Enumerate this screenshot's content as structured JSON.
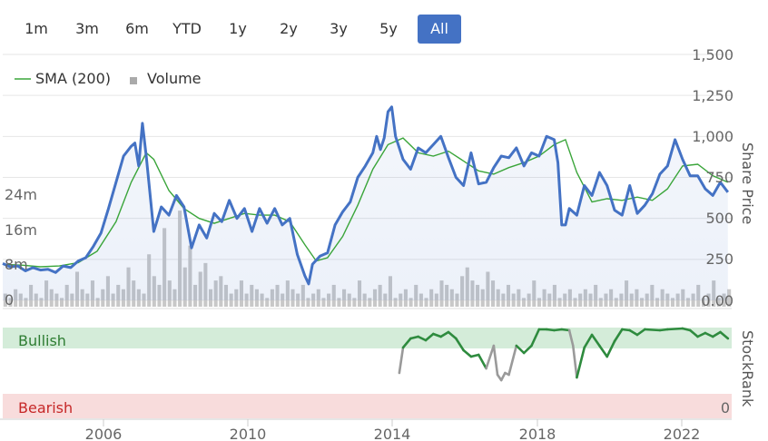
{
  "range_buttons": [
    {
      "label": "1m",
      "active": false
    },
    {
      "label": "3m",
      "active": false
    },
    {
      "label": "6m",
      "active": false
    },
    {
      "label": "YTD",
      "active": false
    },
    {
      "label": "1y",
      "active": false
    },
    {
      "label": "2y",
      "active": false
    },
    {
      "label": "3y",
      "active": false
    },
    {
      "label": "5y",
      "active": false
    },
    {
      "label": "All",
      "active": true
    }
  ],
  "legend": {
    "sma_label": "SMA (200)",
    "volume_label": "Volume"
  },
  "axes": {
    "share_price_title": "Share Price",
    "stockrank_title": "StockRank",
    "price_ticks": [
      "1,500",
      "1,250",
      "1,000",
      "750",
      "500",
      "250",
      "0.00"
    ],
    "volume_ticks": [
      "24m",
      "16m",
      "8m",
      "0"
    ],
    "year_ticks": [
      "2006",
      "2010",
      "2014",
      "2018",
      "2022"
    ],
    "stockrank_zero": "0"
  },
  "zones": {
    "bullish": "Bullish",
    "bearish": "Bearish"
  },
  "colors": {
    "price_line": "#4472c4",
    "sma_line": "#3aa53a",
    "volume_bars": "#c8c8c8",
    "active_button": "#4472c4",
    "bull_zone": "#d4ecd9",
    "bear_zone": "#f8dcdc",
    "rank_bull": "#2e8b3e",
    "rank_neutral": "#9a9a9a"
  },
  "chart_data": {
    "type": "line",
    "x_range": [
      "2004",
      "2023.3"
    ],
    "y_range": [
      0,
      1500
    ],
    "series": [
      {
        "name": "Share Price",
        "points": [
          [
            2004.0,
            225
          ],
          [
            2004.2,
            205
          ],
          [
            2004.4,
            210
          ],
          [
            2004.6,
            180
          ],
          [
            2004.8,
            200
          ],
          [
            2005.0,
            185
          ],
          [
            2005.2,
            190
          ],
          [
            2005.4,
            170
          ],
          [
            2005.6,
            210
          ],
          [
            2005.8,
            200
          ],
          [
            2006.0,
            240
          ],
          [
            2006.2,
            260
          ],
          [
            2006.4,
            330
          ],
          [
            2006.6,
            410
          ],
          [
            2006.8,
            560
          ],
          [
            2007.0,
            720
          ],
          [
            2007.2,
            880
          ],
          [
            2007.4,
            940
          ],
          [
            2007.5,
            960
          ],
          [
            2007.6,
            820
          ],
          [
            2007.7,
            1080
          ],
          [
            2007.8,
            880
          ],
          [
            2008.0,
            420
          ],
          [
            2008.2,
            570
          ],
          [
            2008.4,
            520
          ],
          [
            2008.6,
            640
          ],
          [
            2008.8,
            570
          ],
          [
            2009.0,
            320
          ],
          [
            2009.2,
            460
          ],
          [
            2009.4,
            380
          ],
          [
            2009.6,
            530
          ],
          [
            2009.8,
            480
          ],
          [
            2010.0,
            610
          ],
          [
            2010.2,
            500
          ],
          [
            2010.4,
            560
          ],
          [
            2010.6,
            420
          ],
          [
            2010.8,
            560
          ],
          [
            2011.0,
            470
          ],
          [
            2011.2,
            560
          ],
          [
            2011.4,
            460
          ],
          [
            2011.6,
            500
          ],
          [
            2011.8,
            280
          ],
          [
            2012.0,
            150
          ],
          [
            2012.1,
            100
          ],
          [
            2012.2,
            220
          ],
          [
            2012.4,
            270
          ],
          [
            2012.6,
            290
          ],
          [
            2012.8,
            460
          ],
          [
            2013.0,
            540
          ],
          [
            2013.2,
            600
          ],
          [
            2013.4,
            750
          ],
          [
            2013.6,
            820
          ],
          [
            2013.8,
            900
          ],
          [
            2013.9,
            1000
          ],
          [
            2014.0,
            920
          ],
          [
            2014.1,
            990
          ],
          [
            2014.2,
            1150
          ],
          [
            2014.3,
            1180
          ],
          [
            2014.4,
            1000
          ],
          [
            2014.6,
            860
          ],
          [
            2014.8,
            800
          ],
          [
            2015.0,
            930
          ],
          [
            2015.2,
            900
          ],
          [
            2015.4,
            950
          ],
          [
            2015.6,
            1000
          ],
          [
            2015.8,
            870
          ],
          [
            2016.0,
            750
          ],
          [
            2016.2,
            700
          ],
          [
            2016.4,
            900
          ],
          [
            2016.6,
            710
          ],
          [
            2016.8,
            720
          ],
          [
            2017.0,
            810
          ],
          [
            2017.2,
            880
          ],
          [
            2017.4,
            870
          ],
          [
            2017.6,
            930
          ],
          [
            2017.8,
            820
          ],
          [
            2018.0,
            900
          ],
          [
            2018.2,
            880
          ],
          [
            2018.4,
            1000
          ],
          [
            2018.6,
            980
          ],
          [
            2018.7,
            840
          ],
          [
            2018.8,
            460
          ],
          [
            2018.9,
            460
          ],
          [
            2019.0,
            560
          ],
          [
            2019.2,
            520
          ],
          [
            2019.4,
            700
          ],
          [
            2019.6,
            640
          ],
          [
            2019.8,
            780
          ],
          [
            2020.0,
            700
          ],
          [
            2020.2,
            550
          ],
          [
            2020.4,
            520
          ],
          [
            2020.6,
            700
          ],
          [
            2020.8,
            530
          ],
          [
            2021.0,
            580
          ],
          [
            2021.2,
            650
          ],
          [
            2021.4,
            770
          ],
          [
            2021.6,
            820
          ],
          [
            2021.8,
            980
          ],
          [
            2022.0,
            860
          ],
          [
            2022.2,
            760
          ],
          [
            2022.4,
            760
          ],
          [
            2022.6,
            680
          ],
          [
            2022.8,
            640
          ],
          [
            2023.0,
            720
          ],
          [
            2023.2,
            660
          ]
        ]
      },
      {
        "name": "SMA (200)",
        "points": [
          [
            2004.0,
            220
          ],
          [
            2004.5,
            215
          ],
          [
            2005.0,
            205
          ],
          [
            2005.5,
            210
          ],
          [
            2006.0,
            230
          ],
          [
            2006.5,
            300
          ],
          [
            2007.0,
            480
          ],
          [
            2007.4,
            720
          ],
          [
            2007.8,
            900
          ],
          [
            2008.0,
            860
          ],
          [
            2008.4,
            670
          ],
          [
            2008.8,
            560
          ],
          [
            2009.2,
            500
          ],
          [
            2009.6,
            470
          ],
          [
            2010.0,
            500
          ],
          [
            2010.4,
            530
          ],
          [
            2010.8,
            520
          ],
          [
            2011.2,
            520
          ],
          [
            2011.6,
            480
          ],
          [
            2012.0,
            340
          ],
          [
            2012.3,
            240
          ],
          [
            2012.6,
            260
          ],
          [
            2013.0,
            390
          ],
          [
            2013.4,
            580
          ],
          [
            2013.8,
            800
          ],
          [
            2014.2,
            950
          ],
          [
            2014.6,
            990
          ],
          [
            2015.0,
            900
          ],
          [
            2015.4,
            880
          ],
          [
            2015.8,
            910
          ],
          [
            2016.2,
            850
          ],
          [
            2016.6,
            790
          ],
          [
            2017.0,
            770
          ],
          [
            2017.4,
            810
          ],
          [
            2017.8,
            840
          ],
          [
            2018.2,
            880
          ],
          [
            2018.6,
            950
          ],
          [
            2018.9,
            980
          ],
          [
            2019.2,
            780
          ],
          [
            2019.6,
            600
          ],
          [
            2020.0,
            620
          ],
          [
            2020.4,
            610
          ],
          [
            2020.8,
            630
          ],
          [
            2021.2,
            610
          ],
          [
            2021.6,
            680
          ],
          [
            2022.0,
            820
          ],
          [
            2022.4,
            830
          ],
          [
            2022.8,
            760
          ],
          [
            2023.2,
            720
          ]
        ]
      },
      {
        "name": "Volume",
        "x_start": 2004.0,
        "x_end": 2023.3,
        "unit": "m",
        "values": [
          3,
          2,
          4,
          3,
          2,
          5,
          3,
          2,
          6,
          4,
          3,
          2,
          5,
          3,
          8,
          4,
          3,
          6,
          2,
          4,
          7,
          3,
          5,
          4,
          9,
          6,
          4,
          3,
          12,
          7,
          5,
          18,
          6,
          4,
          22,
          9,
          14,
          5,
          8,
          10,
          4,
          6,
          7,
          5,
          3,
          4,
          6,
          3,
          5,
          4,
          3,
          2,
          4,
          5,
          3,
          6,
          4,
          3,
          5,
          2,
          3,
          4,
          2,
          3,
          5,
          2,
          4,
          3,
          2,
          6,
          3,
          2,
          4,
          5,
          3,
          7,
          2,
          3,
          4,
          2,
          5,
          3,
          2,
          4,
          3,
          6,
          5,
          4,
          3,
          7,
          9,
          6,
          5,
          4,
          8,
          6,
          4,
          3,
          5,
          3,
          4,
          2,
          3,
          6,
          2,
          4,
          3,
          5,
          2,
          3,
          4,
          2,
          3,
          4,
          3,
          5,
          2,
          3,
          4,
          2,
          3,
          6,
          3,
          4,
          2,
          3,
          5,
          2,
          4,
          3,
          2,
          3,
          4,
          2,
          3,
          5,
          2,
          3,
          6,
          2,
          3,
          4
        ]
      }
    ],
    "stockrank": {
      "range": [
        0,
        100
      ],
      "points": [
        [
          2014.5,
          50
        ],
        [
          2014.6,
          78
        ],
        [
          2014.8,
          88
        ],
        [
          2015.0,
          90
        ],
        [
          2015.2,
          86
        ],
        [
          2015.4,
          93
        ],
        [
          2015.6,
          90
        ],
        [
          2015.8,
          95
        ],
        [
          2016.0,
          88
        ],
        [
          2016.2,
          75
        ],
        [
          2016.4,
          68
        ],
        [
          2016.6,
          70
        ],
        [
          2016.8,
          55
        ],
        [
          2017.0,
          80
        ],
        [
          2017.1,
          48
        ],
        [
          2017.2,
          42
        ],
        [
          2017.3,
          50
        ],
        [
          2017.4,
          48
        ],
        [
          2017.6,
          80
        ],
        [
          2017.8,
          72
        ],
        [
          2018.0,
          80
        ],
        [
          2018.2,
          98
        ],
        [
          2018.4,
          98
        ],
        [
          2018.6,
          97
        ],
        [
          2018.8,
          98
        ],
        [
          2019.0,
          97
        ],
        [
          2019.1,
          80
        ],
        [
          2019.2,
          45
        ],
        [
          2019.4,
          78
        ],
        [
          2019.6,
          92
        ],
        [
          2019.8,
          80
        ],
        [
          2020.0,
          68
        ],
        [
          2020.2,
          85
        ],
        [
          2020.4,
          98
        ],
        [
          2020.6,
          97
        ],
        [
          2020.8,
          92
        ],
        [
          2021.0,
          98
        ],
        [
          2021.4,
          97
        ],
        [
          2021.6,
          98
        ],
        [
          2022.0,
          99
        ],
        [
          2022.2,
          97
        ],
        [
          2022.4,
          90
        ],
        [
          2022.6,
          94
        ],
        [
          2022.8,
          90
        ],
        [
          2023.0,
          95
        ],
        [
          2023.2,
          88
        ]
      ],
      "neutral_segments": [
        [
          2014.5,
          2014.6
        ],
        [
          2016.7,
          2017.5
        ],
        [
          2019.05,
          2019.3
        ]
      ]
    }
  }
}
